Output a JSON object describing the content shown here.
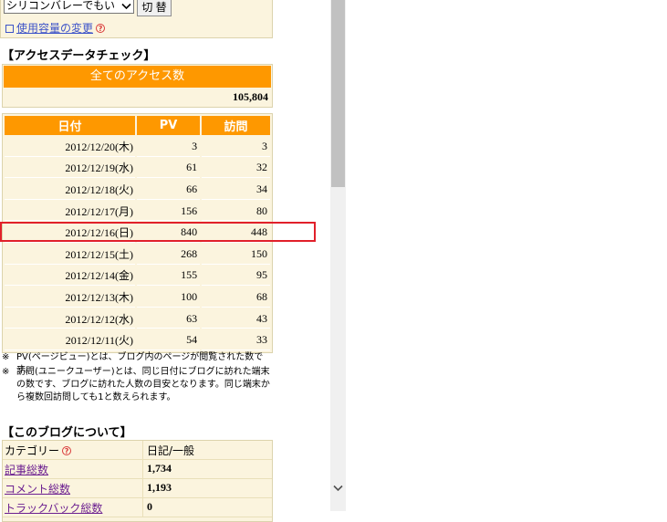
{
  "settings": {
    "region_value": "シリコンバレーでもい",
    "switch_label": "切 替",
    "capacity_link": "使用容量の変更"
  },
  "access_section": {
    "title": "【アクセスデータチェック】",
    "total_header": "全てのアクセス数",
    "total_value": "105,804"
  },
  "table": {
    "headers": [
      "日付",
      "PV",
      "訪問"
    ],
    "rows": [
      {
        "date": "2012/12/20(木)",
        "pv": "3",
        "visits": "3"
      },
      {
        "date": "2012/12/19(水)",
        "pv": "61",
        "visits": "32"
      },
      {
        "date": "2012/12/18(火)",
        "pv": "66",
        "visits": "34"
      },
      {
        "date": "2012/12/17(月)",
        "pv": "156",
        "visits": "80"
      },
      {
        "date": "2012/12/16(日)",
        "pv": "840",
        "visits": "448"
      },
      {
        "date": "2012/12/15(土)",
        "pv": "268",
        "visits": "150"
      },
      {
        "date": "2012/12/14(金)",
        "pv": "155",
        "visits": "95"
      },
      {
        "date": "2012/12/13(木)",
        "pv": "100",
        "visits": "68"
      },
      {
        "date": "2012/12/12(水)",
        "pv": "63",
        "visits": "43"
      },
      {
        "date": "2012/12/11(火)",
        "pv": "54",
        "visits": "33"
      }
    ]
  },
  "notes": [
    {
      "mark": "※",
      "text": "PV(ページビュー)とは、ブログ内のページが閲覧された数です。"
    },
    {
      "mark": "※",
      "text": "訪問(ユニークユーザー)とは、同じ日付にブログに訪れた端末の数です、ブログに訪れた人数の目安となります。同じ端末から複数回訪問しても1と数えられます。"
    }
  ],
  "about_section": {
    "title": "【このブログについて】",
    "rows": [
      {
        "label": "カテゴリー",
        "value": "日記/一般"
      },
      {
        "label": "記事総数",
        "value": "1,734"
      },
      {
        "label": "コメント総数",
        "value": "1,193"
      },
      {
        "label": "トラックバック総数",
        "value": "0"
      }
    ]
  },
  "colors": {
    "accent_orange": "#fe9800",
    "panel_bg": "#fbf4de",
    "highlight_red": "#e1202a",
    "link_blue": "#3d53c8"
  },
  "icons": {
    "help": "question-circle-icon",
    "edit": "edit-icon",
    "dropdown": "chevron-down-icon",
    "scroll_down": "scroll-down-icon"
  }
}
